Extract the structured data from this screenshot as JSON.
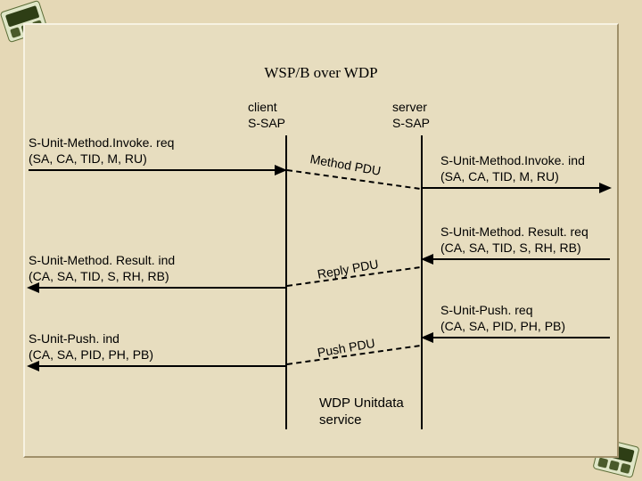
{
  "title": "WSP/B over WDP",
  "client_label": "client\nS-SAP",
  "server_label": "server\nS-SAP",
  "left": {
    "invoke_req": "S-Unit-Method.Invoke. req\n(SA, CA, TID, M, RU)",
    "result_ind": "S-Unit-Method. Result. ind\n(CA, SA, TID, S, RH, RB)",
    "push_ind": "S-Unit-Push. ind\n(CA, SA, PID, PH, PB)"
  },
  "right": {
    "invoke_ind": "S-Unit-Method.Invoke. ind\n(SA, CA, TID, M, RU)",
    "result_req": "S-Unit-Method. Result. req\n(CA, SA, TID, S, RH, RB)",
    "push_req": "S-Unit-Push. req\n(CA, SA, PID, PH, PB)"
  },
  "pdu": {
    "method": "Method PDU",
    "reply": "Reply PDU",
    "push": "Push PDU"
  },
  "wdp_service": "WDP Unitdata\nservice"
}
